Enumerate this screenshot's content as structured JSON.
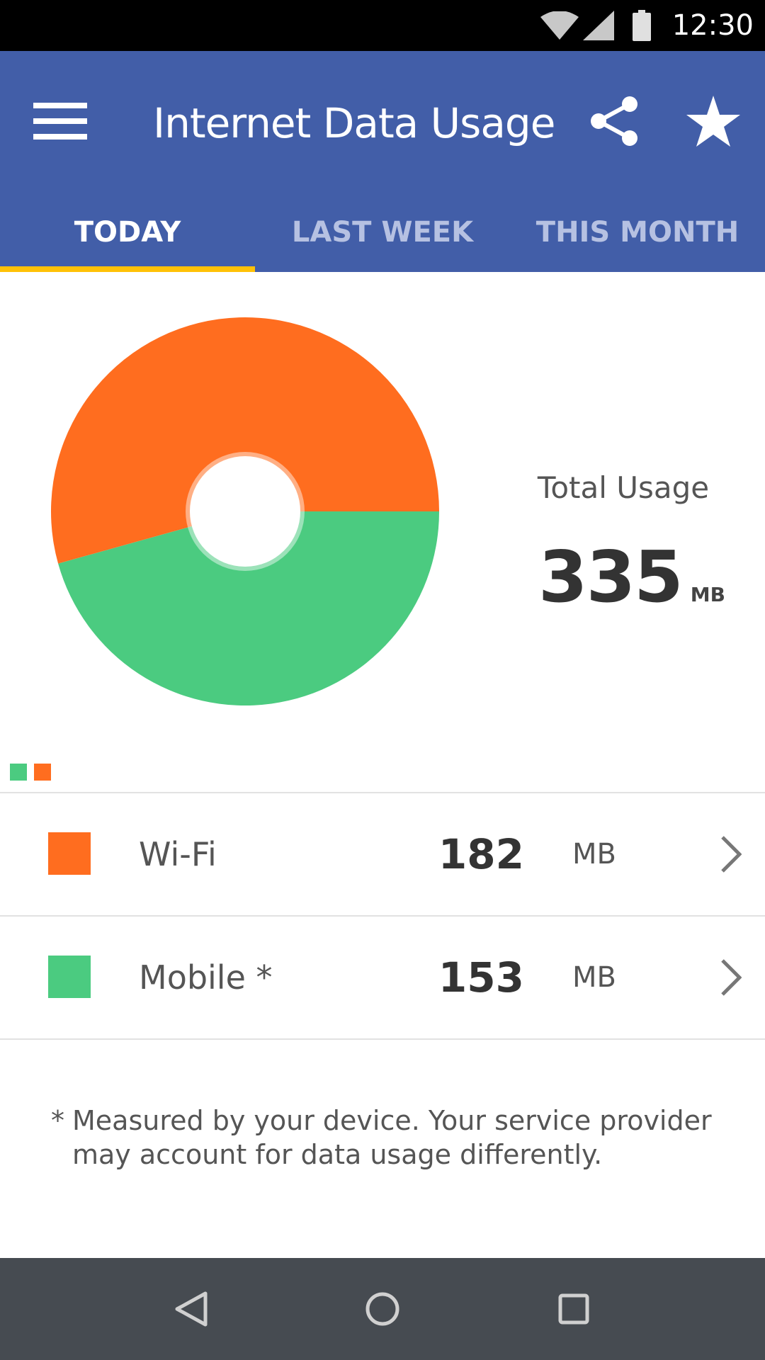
{
  "status_bar": {
    "time": "12:30",
    "icons": [
      "wifi-icon",
      "signal-icon",
      "battery-icon"
    ]
  },
  "app_bar": {
    "title": "Internet Data Usage",
    "menu_icon": "hamburger-menu-icon",
    "share_icon": "share-icon",
    "favorite_icon": "star-icon",
    "background_color": "#425ea8"
  },
  "tabs": [
    {
      "label": "TODAY",
      "active": true
    },
    {
      "label": "LAST WEEK",
      "active": false
    },
    {
      "label": "THIS MONTH",
      "active": false
    }
  ],
  "tab_indicator_color": "#ffc107",
  "summary": {
    "total_label": "Total Usage",
    "total_value": "335",
    "total_unit": "MB"
  },
  "chart_data": {
    "type": "pie",
    "categories": [
      "Wi-Fi",
      "Mobile *"
    ],
    "values": [
      182,
      153
    ],
    "colors": [
      "#ff6d1f",
      "#4bcb80"
    ],
    "unit": "MB",
    "title": ""
  },
  "usage_rows": [
    {
      "label": "Wi-Fi",
      "value": "182",
      "unit": "MB",
      "color": "#ff6d1f"
    },
    {
      "label": "Mobile *",
      "value": "153",
      "unit": "MB",
      "color": "#4bcb80"
    }
  ],
  "footnote": {
    "marker": "*",
    "text": "Measured by your device. Your service provider may account for data usage differently."
  },
  "nav_bar": {
    "buttons": [
      "back-icon",
      "home-icon",
      "recents-icon"
    ]
  }
}
